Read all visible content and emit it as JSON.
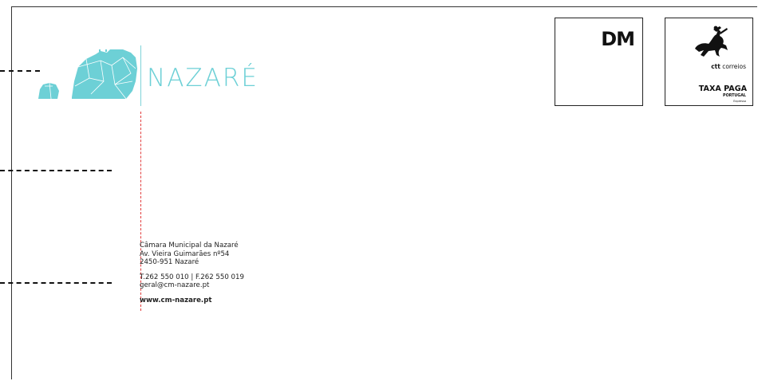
{
  "logo": {
    "text": "NAZARÉ",
    "color": "#6dd0d6"
  },
  "sender": {
    "name": "Câmara Municipal da Nazaré",
    "street": "Av. Vieira Guimarães nº54",
    "postal": "2450-951 Nazaré",
    "phone": "T.262 550 010 | F.262 550 019",
    "email": "geral@cm-nazare.pt",
    "website": "www.cm-nazare.pt"
  },
  "postage": {
    "dm_label": "DM",
    "ctt_brand_bold": "ctt",
    "ctt_brand_rest": " correios",
    "taxa_paga": "TAXA PAGA",
    "country": "PORTUGAL",
    "note": "Expresso"
  },
  "colors": {
    "accent": "#6dd0d6",
    "cut_line": "#e23b3b",
    "text": "#222222"
  },
  "icons": [
    "nazare-landscape-logo-icon",
    "ctt-horse-rider-icon"
  ]
}
